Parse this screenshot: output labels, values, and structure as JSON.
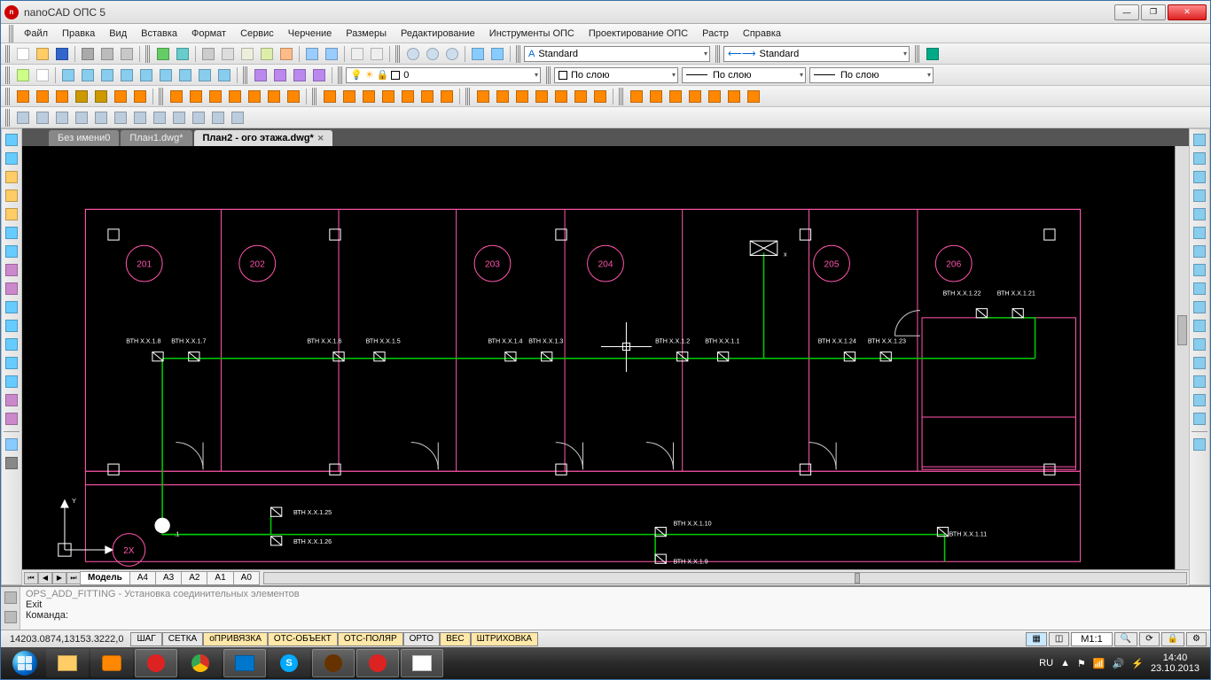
{
  "title": "nanoCAD ОПС 5",
  "menu": [
    "Файл",
    "Правка",
    "Вид",
    "Вставка",
    "Формат",
    "Сервис",
    "Черчение",
    "Размеры",
    "Редактирование",
    "Инструменты ОПС",
    "Проектирование ОПС",
    "Растр",
    "Справка"
  ],
  "combos": {
    "textstyle": "Standard",
    "dimstyle": "Standard",
    "layer": "0",
    "layercolor": "По слою",
    "lineweight": "По слою",
    "linetype": "По слою"
  },
  "doctabs": [
    {
      "label": "Без имени0",
      "active": false
    },
    {
      "label": "План1.dwg*",
      "active": false
    },
    {
      "label": "План2 - ого этажа.dwg*",
      "active": true
    }
  ],
  "layouttabs": [
    "Модель",
    "A4",
    "A3",
    "A2",
    "A1",
    "A0"
  ],
  "activelayout": "Модель",
  "rooms": [
    "201",
    "202",
    "203",
    "204",
    "205",
    "206"
  ],
  "corridor_room": "2Х",
  "annotations_row": [
    "ВТН X.X.1.8",
    "ВТН X.X.1.7",
    "ВТН X.X.1.6",
    "ВТН X.X.1.5",
    "ВТН X.X.1.4",
    "ВТН X.X.1.3",
    "ВТН X.X.1.2",
    "ВТН X.X.1.1",
    "ВТН X.X.1.24",
    "ВТН X.X.1.23"
  ],
  "annotations_206": [
    "ВТН X.X.1.22",
    "ВТН X.X.1.21"
  ],
  "annotations_bottom": [
    "ВТН X.X.1.25",
    "ВТН X.X.1.26",
    "ВТН X.X.1.10",
    "ВТН X.X.1.9",
    "ВТН X.X.1.11"
  ],
  "corridor_dot": ".1",
  "junction_x": "x",
  "cmd": {
    "l1": "OPS_ADD_FITTING - Установка соединительных элементов",
    "l2": "Exit",
    "l3": "Команда:"
  },
  "status": {
    "coords": "14203.0874,13153.3222,0",
    "buttons": [
      {
        "label": "ШАГ",
        "on": false
      },
      {
        "label": "СЕТКА",
        "on": false
      },
      {
        "label": "оПРИВЯЗКА",
        "on": true
      },
      {
        "label": "ОТС-ОБЪЕКТ",
        "on": true
      },
      {
        "label": "ОТС-ПОЛЯР",
        "on": true
      },
      {
        "label": "ОРТО",
        "on": false
      },
      {
        "label": "ВЕС",
        "on": true
      },
      {
        "label": "ШТРИХОВКА",
        "on": true
      }
    ],
    "scale": "М1:1",
    "lang": "RU"
  },
  "clock": {
    "time": "14:40",
    "date": "23.10.2013"
  },
  "colors": {
    "wall": "#ff55aa",
    "wire": "#00cc00",
    "device": "#ffffff"
  }
}
